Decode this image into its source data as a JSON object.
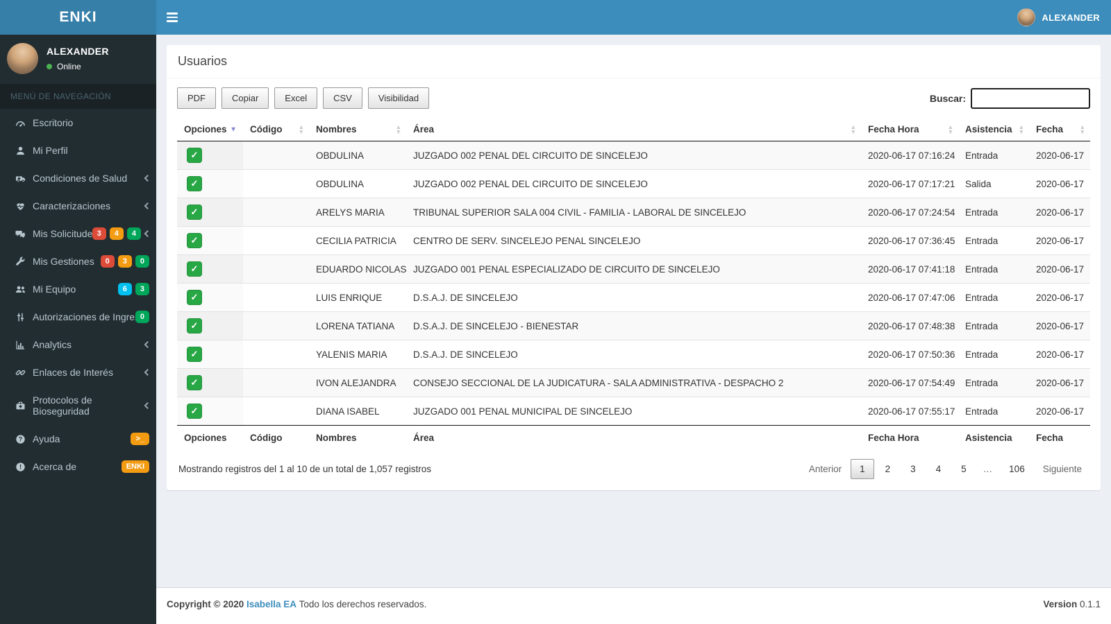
{
  "app": {
    "brand": "ENKI"
  },
  "navbar": {
    "user_name": "ALEXANDER"
  },
  "sidebar": {
    "user": {
      "name": "ALEXANDER",
      "status": "Online"
    },
    "menu_header": "MENÚ DE NAVEGACIÓN",
    "items": [
      {
        "id": "escritorio",
        "label": "Escritorio",
        "icon": "dashboard-icon",
        "chevron": false,
        "badges": []
      },
      {
        "id": "mi-perfil",
        "label": "Mi Perfil",
        "icon": "user-icon",
        "chevron": false,
        "badges": []
      },
      {
        "id": "condiciones-de-salud",
        "label": "Condiciones de Salud",
        "icon": "ambulance-icon",
        "chevron": true,
        "badges": []
      },
      {
        "id": "caracterizaciones",
        "label": "Caracterizaciones",
        "icon": "heartbeat-icon",
        "chevron": true,
        "badges": []
      },
      {
        "id": "mis-solicitudes",
        "label": "Mis Solicitudes",
        "icon": "comments-icon",
        "chevron": true,
        "badges": [
          {
            "text": "3",
            "color": "#dd4b39"
          },
          {
            "text": "4",
            "color": "#f39c12"
          },
          {
            "text": "4",
            "color": "#00a65a"
          }
        ]
      },
      {
        "id": "mis-gestiones",
        "label": "Mis Gestiones",
        "icon": "wrench-icon",
        "chevron": false,
        "badges": [
          {
            "text": "0",
            "color": "#dd4b39"
          },
          {
            "text": "3",
            "color": "#f39c12"
          },
          {
            "text": "0",
            "color": "#00a65a"
          }
        ]
      },
      {
        "id": "mi-equipo",
        "label": "Mi Equipo",
        "icon": "users-icon",
        "chevron": false,
        "badges": [
          {
            "text": "6",
            "color": "#00c0ef"
          },
          {
            "text": "3",
            "color": "#00a65a"
          }
        ]
      },
      {
        "id": "autorizaciones-de-ingreso",
        "label": "Autorizaciones de Ingreso",
        "icon": "sliders-icon",
        "chevron": false,
        "badges": [
          {
            "text": "0",
            "color": "#00a65a"
          }
        ]
      },
      {
        "id": "analytics",
        "label": "Analytics",
        "icon": "bar-chart-icon",
        "chevron": true,
        "badges": []
      },
      {
        "id": "enlaces-de-interes",
        "label": "Enlaces de Interés",
        "icon": "link-icon",
        "chevron": true,
        "badges": []
      },
      {
        "id": "protocolos-de-bioseguridad",
        "label": "Protocolos de Bioseguridad",
        "icon": "medkit-icon",
        "chevron": true,
        "badges": []
      },
      {
        "id": "ayuda",
        "label": "Ayuda",
        "icon": "question-circle-icon",
        "chevron": false,
        "badges": [
          {
            "text": ">_",
            "color": "#f39c12"
          }
        ]
      },
      {
        "id": "acerca-de",
        "label": "Acerca de",
        "icon": "exclamation-circle-icon",
        "chevron": false,
        "badges": [
          {
            "text": "ENKI",
            "color": "#f39c12"
          }
        ]
      }
    ]
  },
  "main": {
    "title": "Usuarios",
    "toolbar": {
      "buttons": [
        "PDF",
        "Copiar",
        "Excel",
        "CSV",
        "Visibilidad"
      ],
      "search_label": "Buscar:",
      "search_value": ""
    },
    "table": {
      "columns": [
        {
          "label": "Opciones",
          "sorted": "desc"
        },
        {
          "label": "Código",
          "sorted": "both"
        },
        {
          "label": "Nombres",
          "sorted": "both"
        },
        {
          "label": "Área",
          "sorted": "both"
        },
        {
          "label": "Fecha Hora",
          "sorted": "both"
        },
        {
          "label": "Asistencia",
          "sorted": "both"
        },
        {
          "label": "Fecha",
          "sorted": "both"
        }
      ],
      "rows": [
        {
          "codigo": "",
          "nombres": "OBDULINA",
          "area": "JUZGADO 002 PENAL DEL CIRCUITO DE SINCELEJO",
          "fecha_hora": "2020-06-17 07:16:24",
          "asistencia": "Entrada",
          "fecha": "2020-06-17"
        },
        {
          "codigo": "",
          "nombres": "OBDULINA",
          "area": "JUZGADO 002 PENAL DEL CIRCUITO DE SINCELEJO",
          "fecha_hora": "2020-06-17 07:17:21",
          "asistencia": "Salida",
          "fecha": "2020-06-17"
        },
        {
          "codigo": "",
          "nombres": "ARELYS MARIA",
          "area": "TRIBUNAL SUPERIOR SALA 004 CIVIL - FAMILIA - LABORAL DE SINCELEJO",
          "fecha_hora": "2020-06-17 07:24:54",
          "asistencia": "Entrada",
          "fecha": "2020-06-17"
        },
        {
          "codigo": "",
          "nombres": "CECILIA PATRICIA",
          "area": "CENTRO DE SERV. SINCELEJO PENAL SINCELEJO",
          "fecha_hora": "2020-06-17 07:36:45",
          "asistencia": "Entrada",
          "fecha": "2020-06-17"
        },
        {
          "codigo": "",
          "nombres": "EDUARDO NICOLAS",
          "area": "JUZGADO 001 PENAL ESPECIALIZADO DE CIRCUITO DE SINCELEJO",
          "fecha_hora": "2020-06-17 07:41:18",
          "asistencia": "Entrada",
          "fecha": "2020-06-17"
        },
        {
          "codigo": "",
          "nombres": "LUIS ENRIQUE",
          "area": "D.S.A.J. DE SINCELEJO",
          "fecha_hora": "2020-06-17 07:47:06",
          "asistencia": "Entrada",
          "fecha": "2020-06-17"
        },
        {
          "codigo": "",
          "nombres": "LORENA TATIANA",
          "area": "D.S.A.J. DE SINCELEJO - BIENESTAR",
          "fecha_hora": "2020-06-17 07:48:38",
          "asistencia": "Entrada",
          "fecha": "2020-06-17"
        },
        {
          "codigo": "",
          "nombres": "YALENIS MARIA",
          "area": "D.S.A.J. DE SINCELEJO",
          "fecha_hora": "2020-06-17 07:50:36",
          "asistencia": "Entrada",
          "fecha": "2020-06-17"
        },
        {
          "codigo": "",
          "nombres": "IVON ALEJANDRA",
          "area": "CONSEJO SECCIONAL DE LA JUDICATURA - SALA ADMINISTRATIVA - DESPACHO 2",
          "fecha_hora": "2020-06-17 07:54:49",
          "asistencia": "Entrada",
          "fecha": "2020-06-17"
        },
        {
          "codigo": "",
          "nombres": "DIANA ISABEL",
          "area": "JUZGADO 001 PENAL MUNICIPAL DE SINCELEJO",
          "fecha_hora": "2020-06-17 07:55:17",
          "asistencia": "Entrada",
          "fecha": "2020-06-17"
        }
      ]
    },
    "info": "Mostrando registros del 1 al 10 de un total de 1,057 registros",
    "pagination": {
      "previous": "Anterior",
      "pages": [
        "1",
        "2",
        "3",
        "4",
        "5",
        "…",
        "106"
      ],
      "active_page": "1",
      "next": "Siguiente"
    }
  },
  "footer": {
    "copyright_prefix": "Copyright © 2020",
    "company": "Isabella EA",
    "copyright_suffix": "Todo los derechos reservados.",
    "version_label": "Version",
    "version": "0.1.1"
  },
  "colors": {
    "navbar": "#3c8dbc",
    "logo_bg": "#367fa9",
    "sidebar": "#222d32",
    "badge_red": "#dd4b39",
    "badge_orange": "#f39c12",
    "badge_green": "#00a65a",
    "badge_cyan": "#00c0ef",
    "checkbox_green": "#28a745",
    "link": "#3c8dbc"
  }
}
